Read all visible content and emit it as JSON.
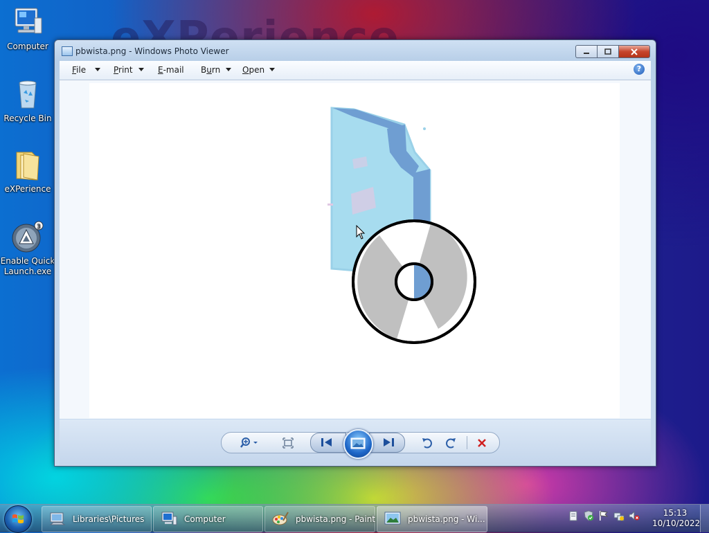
{
  "wallpaper": {
    "watermark_text": "eXPerience"
  },
  "desktop_icons": [
    {
      "label": "Computer",
      "icon": "computer-icon"
    },
    {
      "label": "Recycle Bin",
      "icon": "recycle-bin-icon"
    },
    {
      "label": "eXPerience",
      "icon": "folder-icon"
    },
    {
      "label": "Enable Quick Launch.exe",
      "icon": "quick-launch-app-icon"
    }
  ],
  "window": {
    "title": "pbwista.png - Windows Photo Viewer",
    "controls": {
      "minimize": "minimize-icon",
      "maximize": "maximize-icon",
      "close": "close-icon"
    }
  },
  "menu": {
    "file": {
      "label": "File",
      "underline": "F",
      "rest": "ile"
    },
    "print": {
      "label": "Print",
      "underline": "P",
      "rest": "rint"
    },
    "email": {
      "label": "E-mail",
      "underline": "E",
      "rest": "-mail"
    },
    "burn": {
      "label": "Burn",
      "prefix": "B",
      "underline": "u",
      "rest": "rn"
    },
    "open": {
      "label": "Open",
      "underline": "O",
      "rest": "pen"
    },
    "help": "?"
  },
  "image": {
    "file_name": "pbwista.png",
    "depicts": "disc-and-case-graphic"
  },
  "toolbar": {
    "zoom": "zoom-icon",
    "actual_size": "fit-window-icon",
    "previous": "previous-icon",
    "slideshow": "slideshow-icon",
    "next": "next-icon",
    "rotate_ccw": "rotate-counterclockwise-icon",
    "rotate_cw": "rotate-clockwise-icon",
    "delete": "delete-icon"
  },
  "taskbar": {
    "buttons": [
      {
        "label": "Libraries\\Pictures",
        "icon": "libraries-icon",
        "active": false
      },
      {
        "label": "Computer",
        "icon": "computer-icon",
        "active": false
      },
      {
        "label": "pbwista.png - Paint",
        "icon": "paint-icon",
        "active": false
      },
      {
        "label": "pbwista.png - Wi...",
        "icon": "photo-viewer-icon",
        "active": true
      }
    ],
    "tray_icons": [
      "clipboard-icon",
      "security-shield-icon",
      "action-center-flag-icon",
      "network-icon",
      "volume-muted-icon"
    ],
    "clock": {
      "time": "15:13",
      "date": "10/10/2022"
    }
  },
  "colors": {
    "accent": "#1d66c8",
    "close_red": "#c6452c",
    "delete_red": "#d02020"
  }
}
